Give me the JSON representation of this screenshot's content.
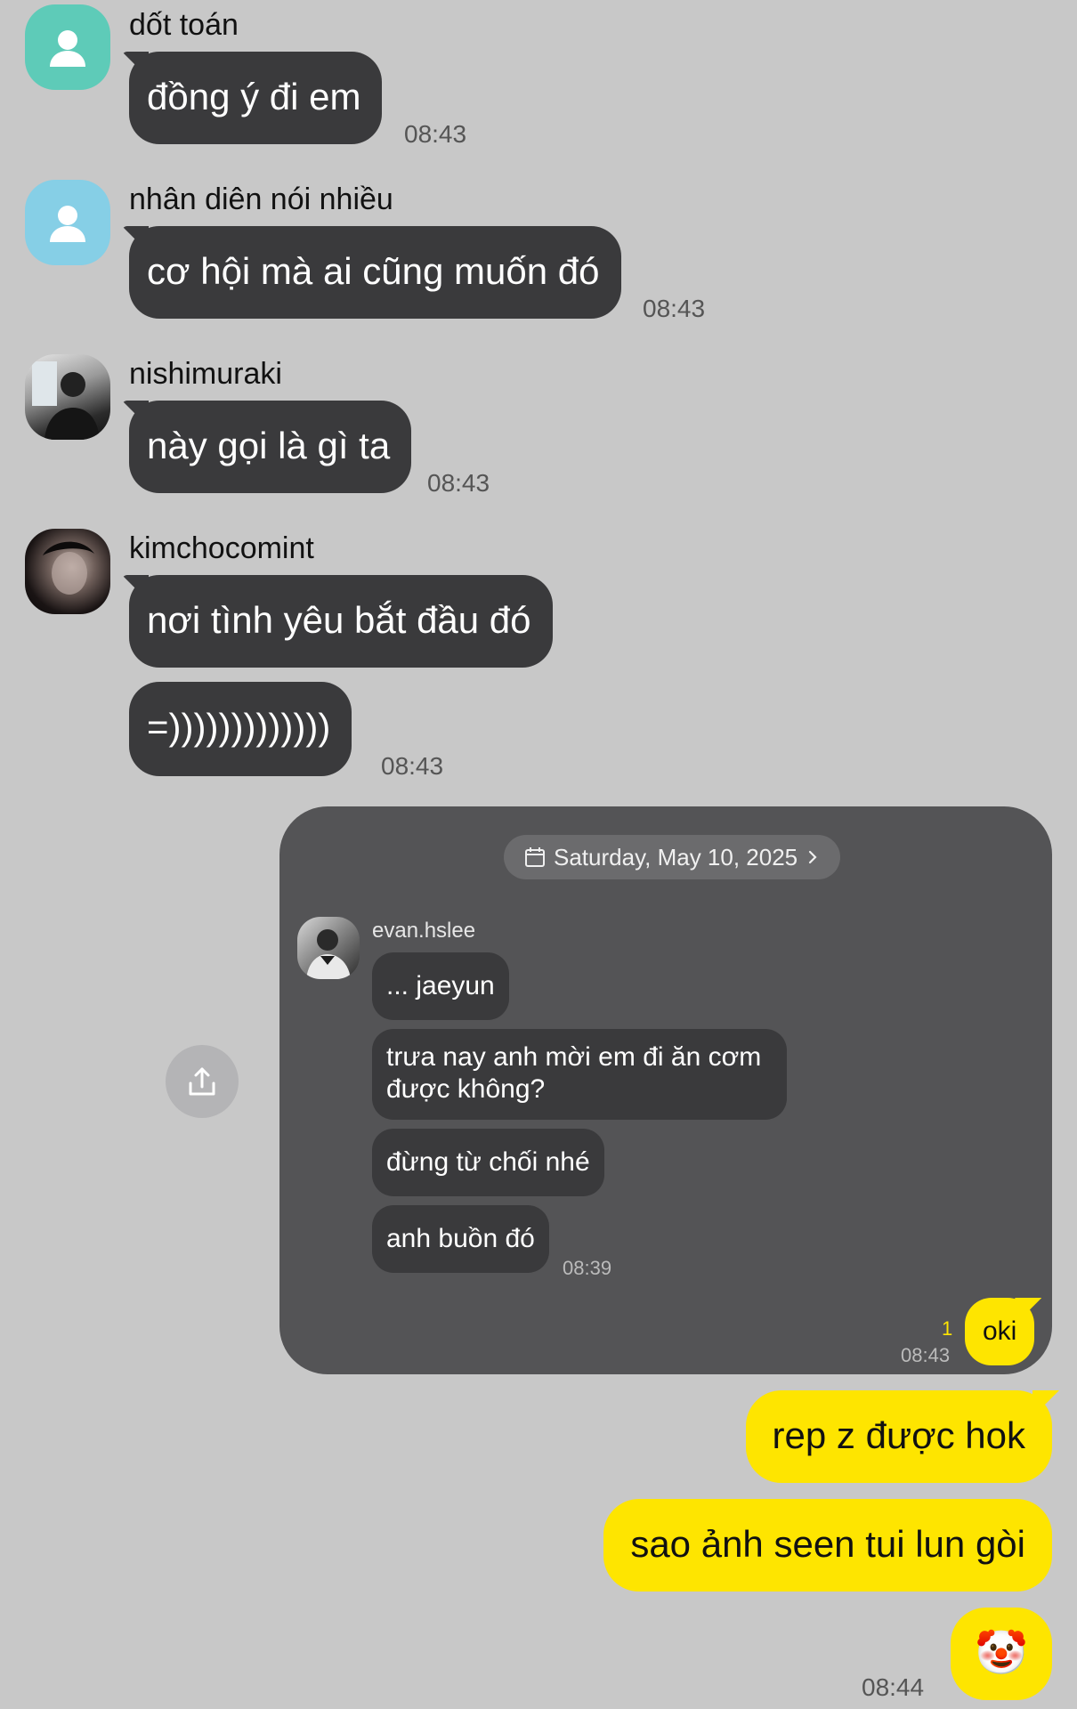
{
  "messages": [
    {
      "sender": "dốt toán",
      "lines": [
        "đồng ý đi em"
      ],
      "time": "08:43"
    },
    {
      "sender": "nhân diên nói nhiều",
      "lines": [
        "cơ hội mà ai cũng muốn đó"
      ],
      "time": "08:43"
    },
    {
      "sender": "nishimuraki",
      "lines": [
        "này gọi là gì ta"
      ],
      "time": "08:43"
    },
    {
      "sender": "kimchocomint",
      "lines": [
        "nơi tình yêu bắt đầu đó",
        "=)))))))))))))"
      ],
      "time": "08:43"
    }
  ],
  "shared_card": {
    "date": "Saturday, May 10, 2025",
    "sender": "evan.hslee",
    "messages": [
      "... jaeyun",
      "trưa nay anh mời em đi ăn cơm được không?",
      "đừng từ chối nhé",
      "anh buồn đó"
    ],
    "inner_time": "08:39",
    "reply": "oki",
    "reply_unread": "1",
    "reply_time": "08:43"
  },
  "my_messages": [
    "rep z được hok",
    "sao ảnh seen tui lun gòi",
    "🤡"
  ],
  "my_time": "08:44",
  "colors": {
    "background": "#c8c8c8",
    "incoming_bubble": "#3a3a3c",
    "outgoing_bubble": "#fee500",
    "card": "#545456",
    "avatar_teal": "#5ecbb8",
    "avatar_blue": "#86cfe6"
  },
  "icons": {
    "default_avatar": "person-silhouette-icon",
    "calendar": "calendar-icon",
    "chevron": "chevron-right-icon",
    "share": "share-icon"
  }
}
